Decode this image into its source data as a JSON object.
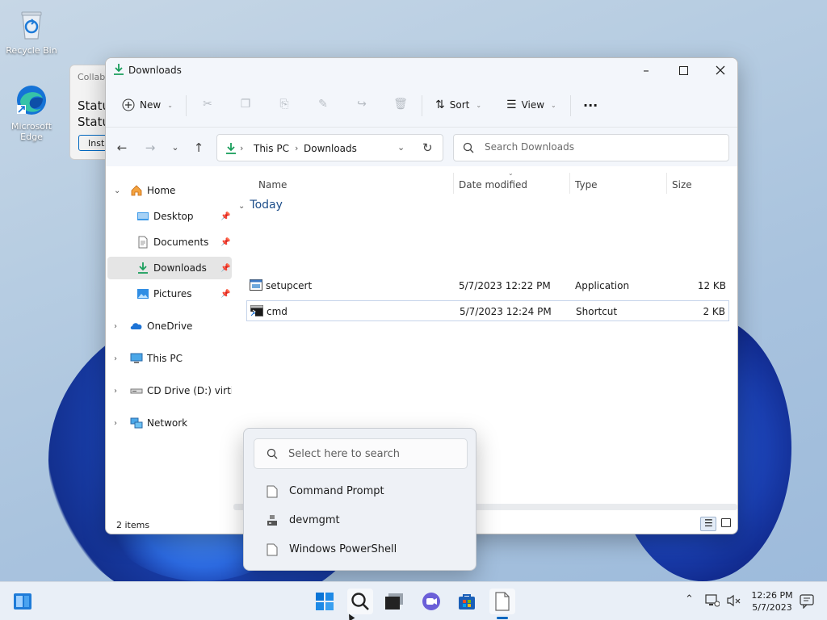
{
  "desktop": {
    "icons": [
      {
        "label": "Recycle Bin"
      },
      {
        "label_line1": "Microsoft",
        "label_line2": "Edge"
      }
    ],
    "bg_window": {
      "title": "Collab",
      "line1": "Statu",
      "line2": "Statu",
      "button": "Insta"
    }
  },
  "explorer": {
    "title": "Downloads",
    "toolbar": {
      "new_label": "New",
      "sort_label": "Sort",
      "view_label": "View",
      "more_label": "···"
    },
    "address": {
      "crumbs": [
        "This PC",
        "Downloads"
      ]
    },
    "search": {
      "placeholder": "Search Downloads"
    },
    "nav": {
      "home": "Home",
      "quick": [
        "Desktop",
        "Documents",
        "Downloads",
        "Pictures"
      ],
      "roots": [
        "OneDrive",
        "This PC",
        "CD Drive (D:) virtio-win",
        "Network"
      ]
    },
    "columns": {
      "name": "Name",
      "date": "Date modified",
      "type": "Type",
      "size": "Size"
    },
    "group": "Today",
    "files": [
      {
        "name": "setupcert",
        "date": "5/7/2023 12:22 PM",
        "type": "Application",
        "size": "12 KB"
      },
      {
        "name": "cmd",
        "date": "5/7/2023 12:24 PM",
        "type": "Shortcut",
        "size": "2 KB"
      }
    ],
    "status": "2 items"
  },
  "popup": {
    "placeholder": "Select here to search",
    "items": [
      "Command Prompt",
      "devmgmt",
      "Windows PowerShell"
    ]
  },
  "taskbar": {
    "time": "12:26 PM",
    "date": "5/7/2023"
  },
  "colors": {
    "accent": "#0067c0",
    "selection": "#e5e5e5",
    "download_green": "#1a9e5c"
  }
}
